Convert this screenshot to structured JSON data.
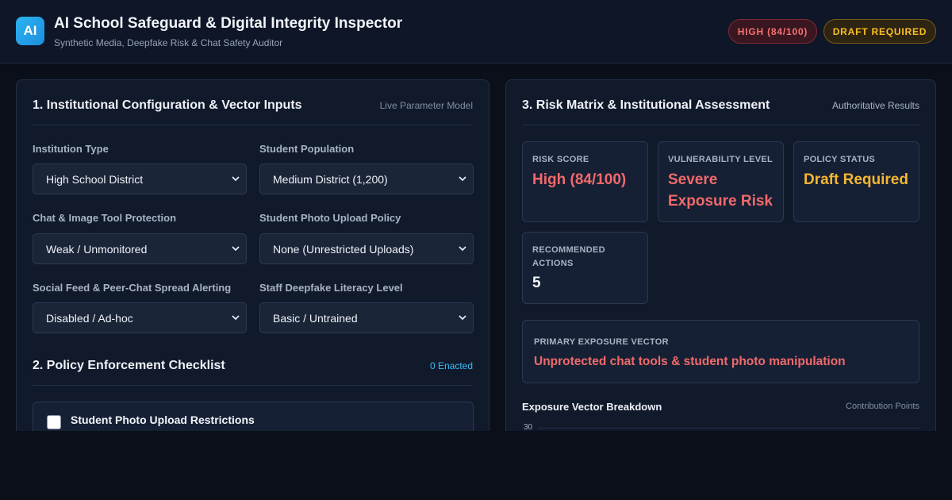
{
  "header": {
    "logo_text": "AI",
    "title": "AI School Safeguard & Digital Integrity Inspector",
    "subtitle": "Synthetic Media, Deepfake Risk & Chat Safety Auditor",
    "badge_risk": "HIGH (84/100)",
    "badge_status": "DRAFT REQUIRED"
  },
  "config": {
    "title": "1. Institutional Configuration & Vector Inputs",
    "note": "Live Parameter Model",
    "fields": [
      {
        "label": "Institution Type",
        "value": "High School District"
      },
      {
        "label": "Student Population",
        "value": "Medium District (1,200)"
      },
      {
        "label": "Chat & Image Tool Protection",
        "value": "Weak / Unmonitored"
      },
      {
        "label": "Student Photo Upload Policy",
        "value": "None (Unrestricted Uploads)"
      },
      {
        "label": "Social Feed & Peer-Chat Spread Alerting",
        "value": "Disabled / Ad-hoc"
      },
      {
        "label": "Staff Deepfake Literacy Level",
        "value": "Basic / Untrained"
      }
    ]
  },
  "checklist": {
    "title": "2. Policy Enforcement Checklist",
    "note": "0 Enacted",
    "items": [
      {
        "label": "Student Photo Upload Restrictions",
        "checked": false
      }
    ]
  },
  "assessment": {
    "title": "3. Risk Matrix & Institutional Assessment",
    "note": "Authoritative Results",
    "metrics": [
      {
        "label": "RISK SCORE",
        "value": "High (84/100)",
        "tone": "red"
      },
      {
        "label": "VULNERABILITY LEVEL",
        "value": "Severe Exposure Risk",
        "tone": "red"
      },
      {
        "label": "POLICY STATUS",
        "value": "Draft Required",
        "tone": "amber"
      },
      {
        "label": "RECOMMENDED ACTIONS",
        "value": "5",
        "tone": "white"
      }
    ],
    "primary_vector_label": "PRIMARY EXPOSURE VECTOR",
    "primary_vector_value": "Unprotected chat tools & student photo manipulation"
  },
  "chart_data": {
    "type": "bar",
    "title": "Exposure Vector Breakdown",
    "note": "Contribution Points",
    "y_ticks": [
      "30"
    ]
  },
  "colors": {
    "accent_red": "#f06a6a",
    "accent_amber": "#f5b731",
    "accent_blue": "#38bdf8",
    "background": "#0a0f19",
    "panel": "#111a2b"
  }
}
